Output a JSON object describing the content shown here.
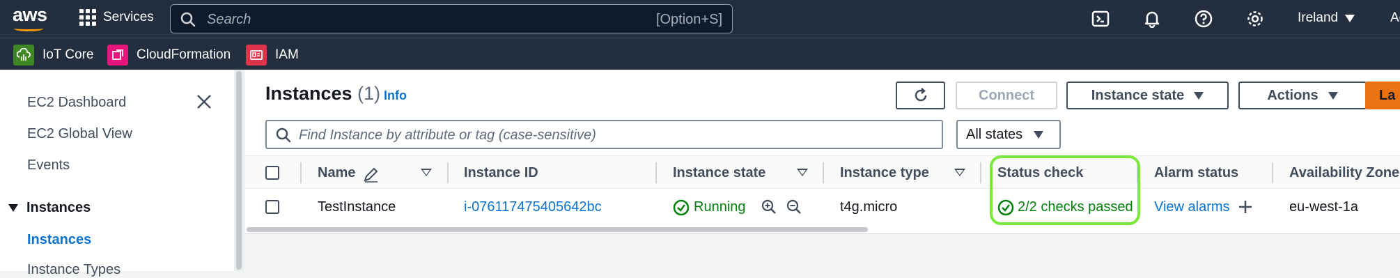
{
  "topnav": {
    "logo": "aws",
    "services_label": "Services",
    "search_placeholder": "Search",
    "search_shortcut": "[Option+S]",
    "region": "Ireland",
    "account_truncated": "Ac"
  },
  "favorites": [
    {
      "label": "IoT Core",
      "color": "#3f8624"
    },
    {
      "label": "CloudFormation",
      "color": "#e7157b"
    },
    {
      "label": "IAM",
      "color": "#dd344c"
    }
  ],
  "sidebar": {
    "items": [
      "EC2 Dashboard",
      "EC2 Global View",
      "Events"
    ],
    "section": "Instances",
    "active_item": "Instances",
    "cut_item": "Instance Types"
  },
  "page": {
    "title": "Instances",
    "count": "(1)",
    "info": "Info"
  },
  "toolbar": {
    "connect": "Connect",
    "instance_state": "Instance state",
    "actions": "Actions",
    "launch_truncated": "La"
  },
  "filter": {
    "placeholder": "Find Instance by attribute or tag (case-sensitive)",
    "states_select": "All states"
  },
  "table": {
    "columns": [
      "Name",
      "Instance ID",
      "Instance state",
      "Instance type",
      "Status check",
      "Alarm status",
      "Availability Zone"
    ],
    "rows": [
      {
        "name": "TestInstance",
        "instance_id": "i-076117475405642bc",
        "state": "Running",
        "type": "t4g.micro",
        "status_check": "2/2 checks passed",
        "alarm": "View alarms",
        "az": "eu-west-1a"
      }
    ]
  },
  "colors": {
    "nav_bg": "#232f3e",
    "link": "#0972d3",
    "success": "#037f0c",
    "primary_btn": "#ec7211",
    "highlight": "#7be83e"
  }
}
